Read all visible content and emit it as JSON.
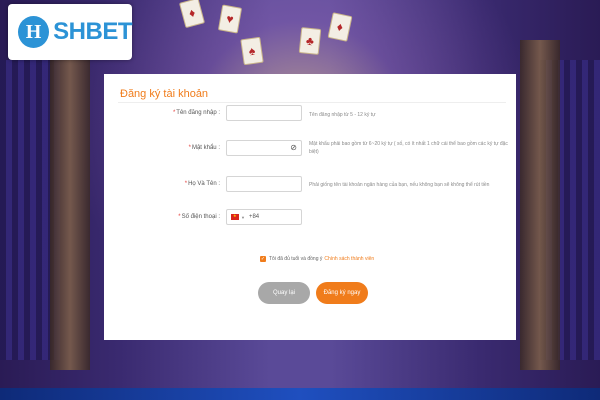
{
  "brand": {
    "logo_mark": "H",
    "logo_text": "SHBET"
  },
  "form": {
    "title": "Đăng ký tài khoản",
    "fields": [
      {
        "label": "Tên đăng nhập",
        "value": "",
        "hint": "Tên đăng nhập từ 5 - 12 ký tự"
      },
      {
        "label": "Mật khẩu",
        "value": "",
        "hint": "Mật khẩu phải bao gồm từ 6~20 ký tự ( số, có ít nhất 1 chữ cái thể bao gồm các ký tự đặc biệt)"
      },
      {
        "label": "Họ Và Tên",
        "value": "",
        "hint": "Phải giống tên tài khoản ngân hàng của bạn, nếu không bạn sẽ không thể rút tiền"
      },
      {
        "label": "Số điện thoại",
        "value": "",
        "prefix": "+84"
      }
    ],
    "agree_text": "Tôi đã đủ tuổi và đồng ý",
    "agree_link": "Chính sách thành viên",
    "back_label": "Quay lại",
    "submit_label": "Đăng ký ngay"
  },
  "colors": {
    "accent": "#f07c1b",
    "brand": "#2c93d6",
    "secondary_button": "#a8a8a8"
  },
  "icons": {
    "password_toggle": "eye-off-icon",
    "phone_flag": "vietnam-flag-icon"
  }
}
